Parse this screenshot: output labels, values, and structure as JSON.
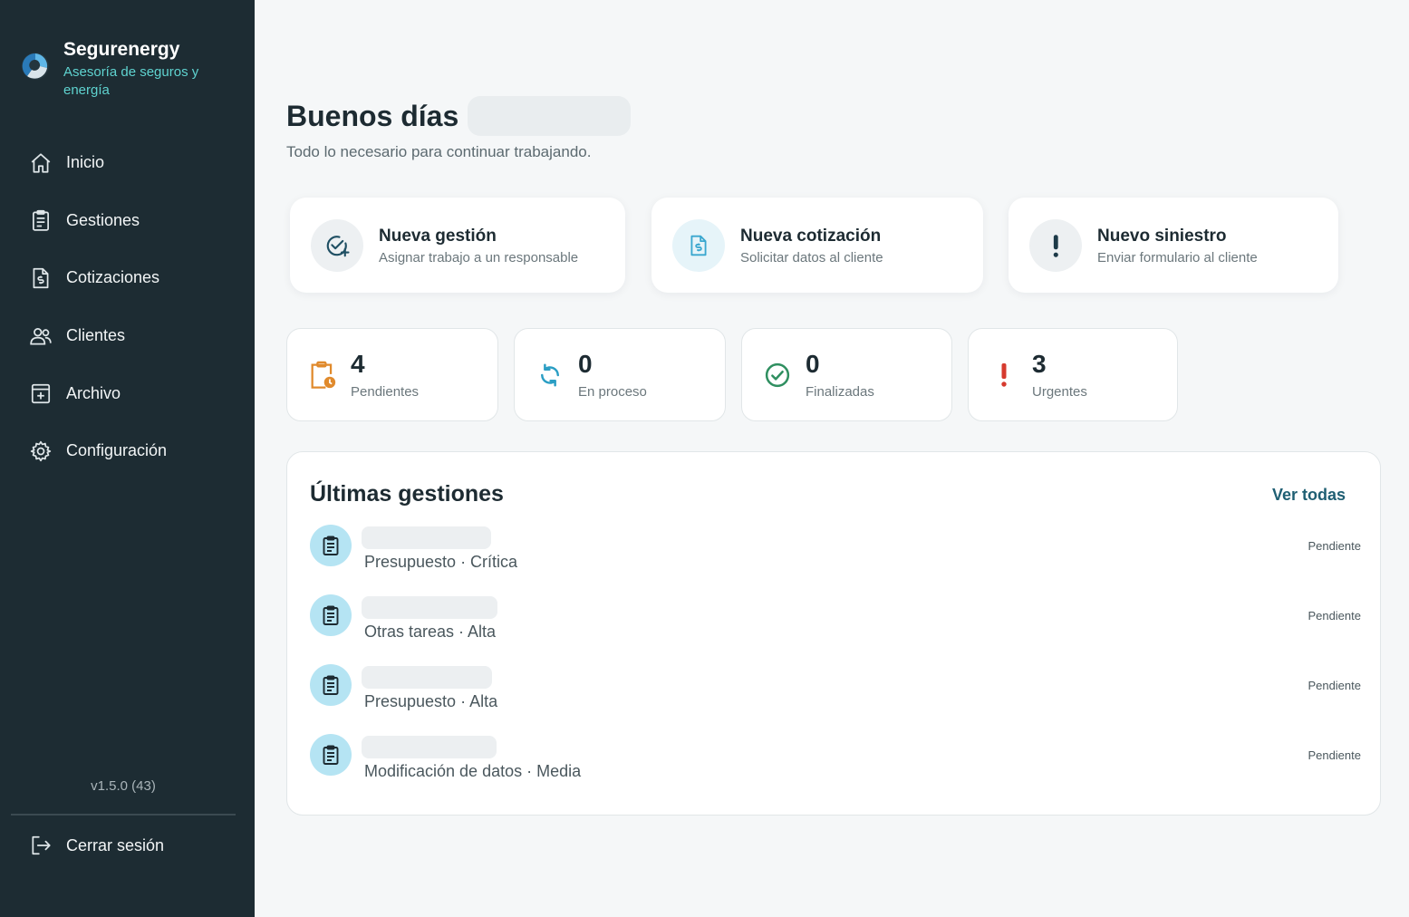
{
  "brand": {
    "name": "Segurenergy",
    "tagline": "Asesoría de seguros y energía"
  },
  "nav": [
    {
      "label": "Inicio",
      "icon": "home-icon"
    },
    {
      "label": "Gestiones",
      "icon": "clipboard-list-icon"
    },
    {
      "label": "Cotizaciones",
      "icon": "invoice-icon"
    },
    {
      "label": "Clientes",
      "icon": "users-icon"
    },
    {
      "label": "Archivo",
      "icon": "archive-icon"
    },
    {
      "label": "Configuración",
      "icon": "gear-icon"
    }
  ],
  "version": "v1.5.0 (43)",
  "logout": {
    "label": "Cerrar sesión",
    "icon": "logout-icon"
  },
  "header": {
    "greeting": "Buenos días",
    "subtitle": "Todo lo necesario para continuar trabajando."
  },
  "actions": [
    {
      "title": "Nueva gestión",
      "subtitle": "Asignar trabajo a un responsable",
      "icon": "check-add-icon"
    },
    {
      "title": "Nueva cotización",
      "subtitle": "Solicitar datos al cliente",
      "icon": "invoice-icon"
    },
    {
      "title": "Nuevo siniestro",
      "subtitle": "Enviar formulario al cliente",
      "icon": "exclamation-icon"
    }
  ],
  "stats": [
    {
      "value": "4",
      "label": "Pendientes",
      "icon": "clipboard-clock-icon",
      "color": "#e08a2c"
    },
    {
      "value": "0",
      "label": "En proceso",
      "icon": "refresh-icon",
      "color": "#2b9ec4"
    },
    {
      "value": "0",
      "label": "Finalizadas",
      "icon": "check-circle-icon",
      "color": "#2f8f60"
    },
    {
      "value": "3",
      "label": "Urgentes",
      "icon": "exclamation-icon",
      "color": "#d63a2e"
    }
  ],
  "recent": {
    "title": "Últimas gestiones",
    "see_all": "Ver todas",
    "items": [
      {
        "meta": "Presupuesto · Crítica",
        "status": "Pendiente"
      },
      {
        "meta": "Otras tareas · Alta",
        "status": "Pendiente"
      },
      {
        "meta": "Presupuesto · Alta",
        "status": "Pendiente"
      },
      {
        "meta": "Modificación de datos · Media",
        "status": "Pendiente"
      }
    ]
  },
  "colors": {
    "sidebar_bg": "#1d2c33",
    "accent_teal": "#5fd3d0",
    "link": "#1f5f73",
    "row_icon_bg": "#b5e4f3"
  }
}
